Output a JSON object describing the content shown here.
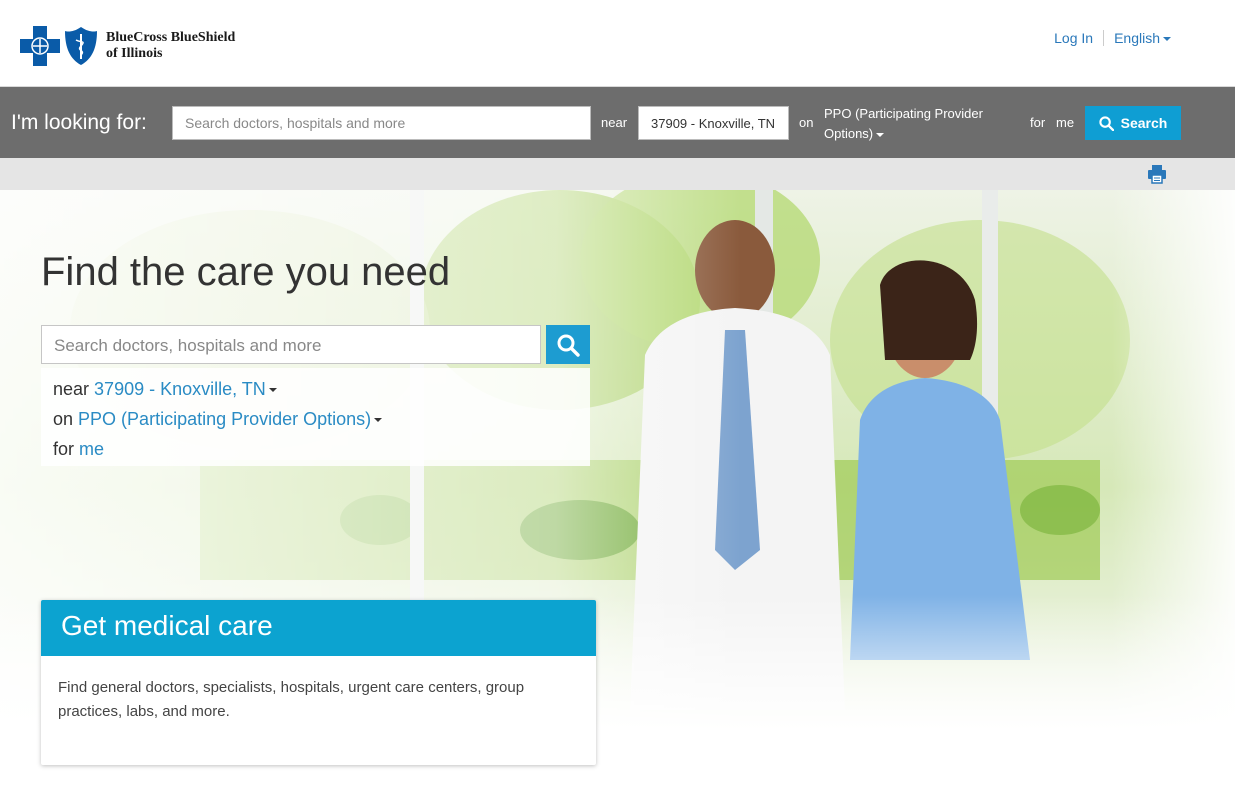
{
  "header": {
    "brand_line1": "BlueCross BlueShield",
    "brand_line2": "of Illinois",
    "login": "Log In",
    "language": "English",
    "brand_color": "#0a5ba8"
  },
  "search_strip": {
    "label": "I'm looking for:",
    "search_placeholder": "Search doctors, hospitals and more",
    "near_label": "near",
    "location_value": "37909 - Knoxville, TN",
    "on_label": "on",
    "plan_value": "PPO (Participating Provider Options)",
    "for_label": "for",
    "for_value": "me",
    "search_button": "Search",
    "accent_color": "#0f9ed3"
  },
  "hero": {
    "title": "Find the care you need",
    "search_placeholder": "Search doctors, hospitals and more",
    "near_label": "near",
    "location_value": "37909 - Knoxville, TN",
    "on_label": "on",
    "plan_value": "PPO (Participating Provider Options)",
    "for_label": "for",
    "for_value": "me"
  },
  "care_card": {
    "heading": "Get medical care",
    "description": "Find general doctors, specialists, hospitals, urgent care centers, group practices, labs, and more."
  },
  "icons": {
    "search": "search-icon",
    "print": "print-icon",
    "logo_cross": "bluecross-logo-icon",
    "logo_shield": "blueshield-logo-icon"
  }
}
